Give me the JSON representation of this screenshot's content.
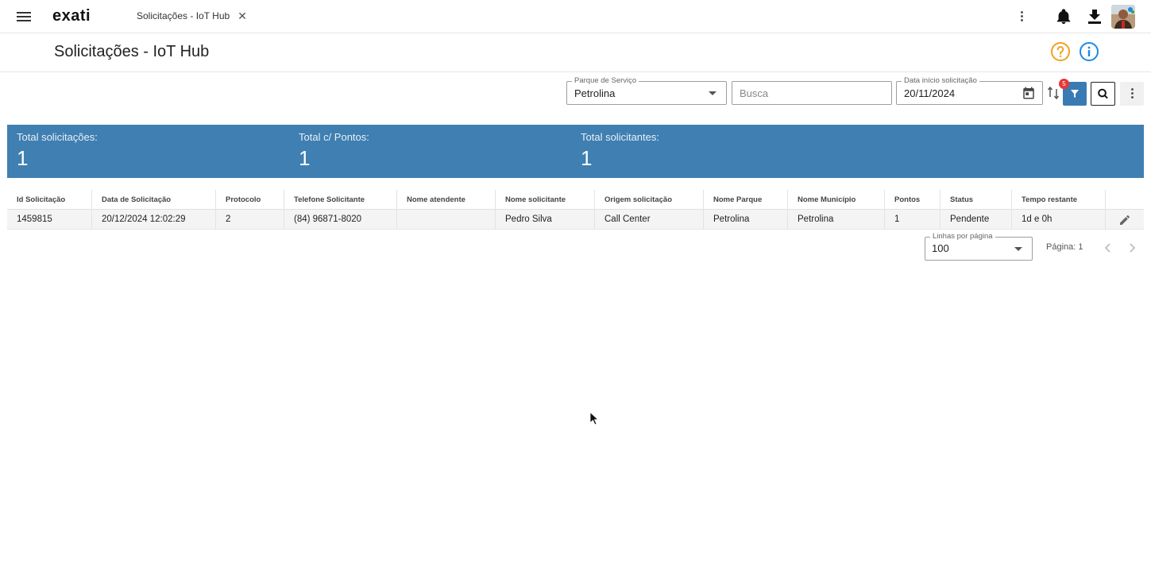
{
  "topbar": {
    "logo": "exati",
    "tab_title": "Solicitações - IoT Hub",
    "tab_close": "✕"
  },
  "header": {
    "title": "Solicitações - IoT Hub"
  },
  "filters": {
    "parque": {
      "label": "Parque de Serviço",
      "value": "Petrolina"
    },
    "busca": {
      "placeholder": "Busca",
      "value": ""
    },
    "data_inicio": {
      "label": "Data início solicitação",
      "value": "20/11/2024"
    },
    "filter_badge": "5"
  },
  "summary": {
    "stats": [
      {
        "label": "Total solicitações:",
        "value": "1"
      },
      {
        "label": "Total c/ Pontos:",
        "value": "1"
      },
      {
        "label": "Total solicitantes:",
        "value": "1"
      }
    ]
  },
  "table": {
    "columns": [
      "Id Solicitação",
      "Data de Solicitação",
      "Protocolo",
      "Telefone Solicitante",
      "Nome atendente",
      "Nome solicitante",
      "Origem solicitação",
      "Nome Parque",
      "Nome Município",
      "Pontos",
      "Status",
      "Tempo restante"
    ],
    "rows": [
      [
        "1459815",
        "20/12/2024 12:02:29",
        "2",
        "(84) 96871-8020",
        "",
        "Pedro Silva",
        "Call Center",
        "Petrolina",
        "Petrolina",
        "1",
        "Pendente",
        "1d e 0h"
      ]
    ]
  },
  "pagination": {
    "rows_label": "Linhas por página",
    "rows_value": "100",
    "page_label": "Página: 1"
  },
  "colors": {
    "summary_band": "#3f7fb1",
    "filter_button": "#3a7ab3",
    "help_icon": "#f0a21c",
    "info_icon": "#1e88e5",
    "badge": "#e53935"
  },
  "icons": [
    "menu-icon",
    "close-icon",
    "more-vert-icon",
    "bell-icon",
    "download-icon",
    "help-icon",
    "info-icon",
    "chevron-down-icon",
    "calendar-icon",
    "sort-icon",
    "filter-icon",
    "search-icon",
    "edit-icon",
    "chevron-left-icon",
    "chevron-right-icon"
  ]
}
